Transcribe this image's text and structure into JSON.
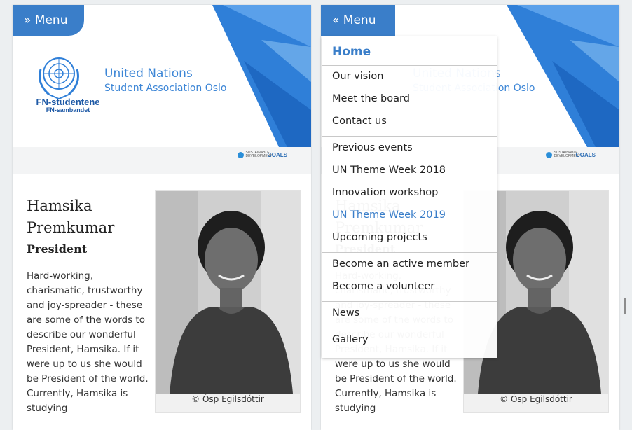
{
  "menu": {
    "closed_label": "» Menu",
    "open_label": "« Menu"
  },
  "banner": {
    "org_short": "FN-studentene",
    "org_sub": "FN-sambandet",
    "title_line1": "United Nations",
    "title_line2": "Student Association Oslo",
    "sdg_small": "SUSTAINABLE DEVELOPMENT",
    "sdg_goals": "GOALS"
  },
  "profile": {
    "name": "Hamsika Premkumar",
    "role": "President",
    "bio": "Hard-working, charismatic, trustworthy and joy-spreader - these are some of the words to describe our wonderful President, Hamsika. If it were up to us she would be President of the world. Currently, Hamsika is studying",
    "photo_credit": "© Ósp Egilsdóttir"
  },
  "nav": {
    "home": "Home",
    "our_vision": "Our vision",
    "meet_board": "Meet the board",
    "contact": "Contact us",
    "previous_events": "Previous events",
    "theme_week_2018": "UN Theme Week 2018",
    "innovation": "Innovation workshop",
    "theme_week_2019": "UN Theme Week 2019",
    "upcoming": "Upcoming projects",
    "active_member": "Become an active member",
    "volunteer": "Become a volunteer",
    "news": "News",
    "gallery": "Gallery"
  },
  "colors": {
    "accent": "#3a7ec9",
    "banner_blue": "#2f7fd8"
  }
}
